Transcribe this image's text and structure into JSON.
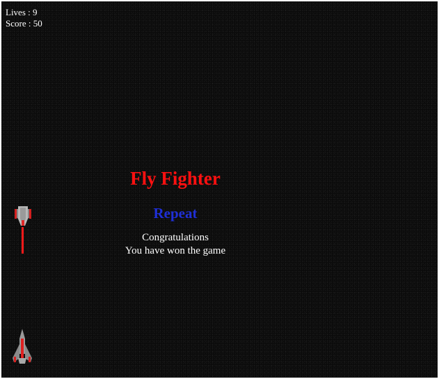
{
  "hud": {
    "lives_label": "Lives : 9",
    "score_label": "Score : 50"
  },
  "menu": {
    "title": "Fly Fighter",
    "repeat_label": "Repeat",
    "message_line1": "Congratulations",
    "message_line2": "You have won the game"
  },
  "colors": {
    "background": "#0b0b0b",
    "title": "#ff1010",
    "repeat": "#1f2fd6",
    "text": "#ffffff"
  },
  "sprites": {
    "enemy": "enemy-ship-icon",
    "player": "player-ship-icon"
  }
}
